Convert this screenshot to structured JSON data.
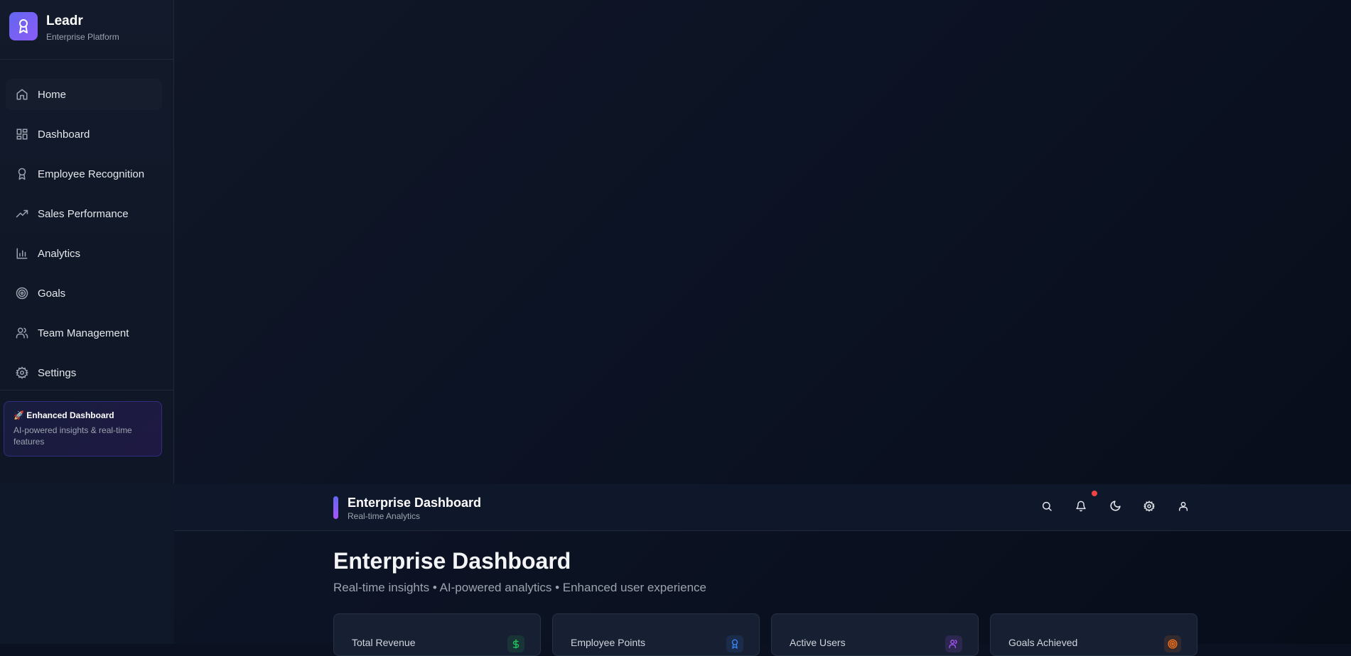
{
  "brand": {
    "name": "Leadr",
    "subtitle": "Enterprise Platform"
  },
  "sidebar": {
    "items": [
      {
        "label": "Home",
        "icon": "home-icon"
      },
      {
        "label": "Dashboard",
        "icon": "dashboard-grid-icon"
      },
      {
        "label": "Employee Recognition",
        "icon": "award-icon"
      },
      {
        "label": "Sales Performance",
        "icon": "trending-up-icon"
      },
      {
        "label": "Analytics",
        "icon": "bar-chart-icon"
      },
      {
        "label": "Goals",
        "icon": "target-icon"
      },
      {
        "label": "Team Management",
        "icon": "users-icon"
      },
      {
        "label": "Settings",
        "icon": "gear-icon"
      }
    ],
    "promo": {
      "title": "🚀 Enhanced Dashboard",
      "text": "AI-powered insights & real-time features"
    }
  },
  "header": {
    "title": "Enterprise Dashboard",
    "subtitle": "Real-time Analytics",
    "actions": [
      "search-icon",
      "bell-icon",
      "moon-icon",
      "gear-icon",
      "user-icon"
    ]
  },
  "main": {
    "title": "Enterprise Dashboard",
    "subtitle": "Real-time insights • AI-powered analytics • Enhanced user experience",
    "stats": [
      {
        "label": "Total Revenue",
        "icon": "dollar-icon",
        "color": "#22c55e"
      },
      {
        "label": "Employee Points",
        "icon": "award-icon",
        "color": "#3b82f6"
      },
      {
        "label": "Active Users",
        "icon": "users-icon",
        "color": "#a855f7"
      },
      {
        "label": "Goals Achieved",
        "icon": "target-icon",
        "color": "#f97316"
      }
    ]
  },
  "colors": {
    "accent": "#6366f1",
    "accent2": "#8b5cf6",
    "notification": "#ef4444"
  }
}
